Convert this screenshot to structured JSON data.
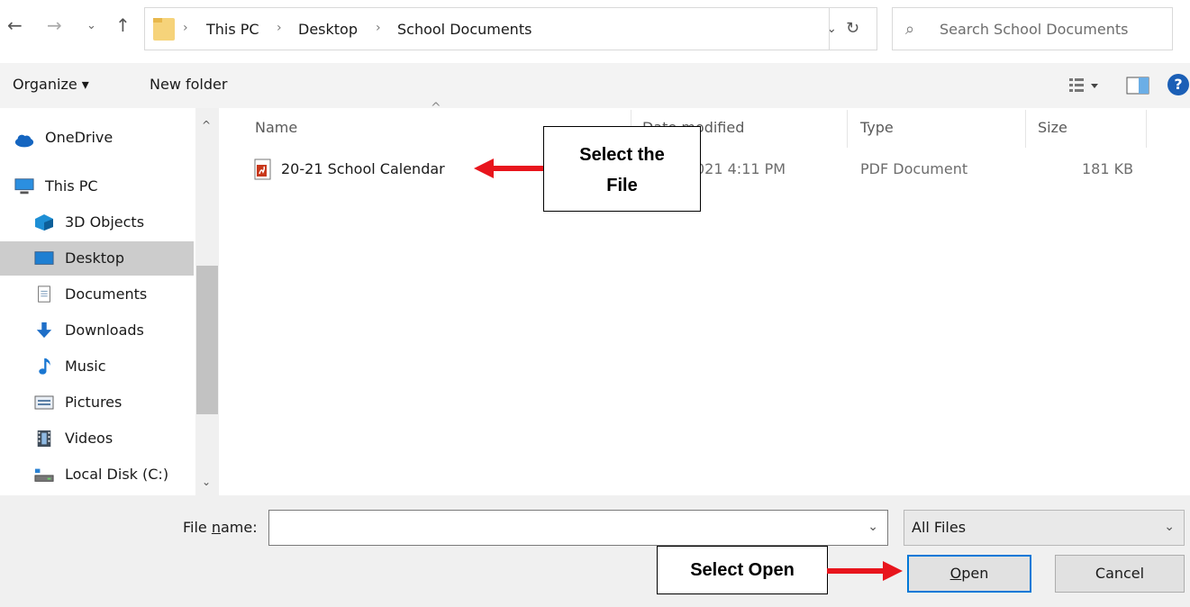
{
  "nav": {
    "back_icon": "back-arrow-icon",
    "forward_icon": "forward-arrow-icon",
    "recent_icon": "chevron-down-icon",
    "up_icon": "up-arrow-icon"
  },
  "address_bar": {
    "breadcrumbs": [
      "This PC",
      "Desktop",
      "School Documents"
    ],
    "separator": "›"
  },
  "search": {
    "placeholder": "Search School Documents"
  },
  "toolbar": {
    "organize_label": "Organize ▾",
    "new_folder_label": "New folder"
  },
  "sidebar": {
    "items": [
      {
        "label": "OneDrive",
        "icon": "cloud-icon"
      },
      {
        "label": "This PC",
        "icon": "computer-icon"
      },
      {
        "label": "3D Objects",
        "icon": "cube-icon"
      },
      {
        "label": "Desktop",
        "icon": "desktop-icon",
        "selected": true
      },
      {
        "label": "Documents",
        "icon": "document-icon"
      },
      {
        "label": "Downloads",
        "icon": "download-icon"
      },
      {
        "label": "Music",
        "icon": "music-note-icon"
      },
      {
        "label": "Pictures",
        "icon": "picture-icon"
      },
      {
        "label": "Videos",
        "icon": "film-icon"
      },
      {
        "label": "Local Disk (C:)",
        "icon": "drive-icon"
      }
    ]
  },
  "file_list": {
    "columns": [
      "Name",
      "Date modified",
      "Type",
      "Size"
    ],
    "rows": [
      {
        "name": "20-21 School Calendar",
        "date": "021 4:11 PM",
        "type": "PDF Document",
        "size": "181 KB",
        "icon": "pdf-icon"
      }
    ]
  },
  "callouts": {
    "file_line1": "Select the",
    "file_line2": "File",
    "open": "Select Open"
  },
  "footer": {
    "file_name_label_pre": "File ",
    "file_name_label_key": "n",
    "file_name_label_post": "ame:",
    "file_name_value": "",
    "filter_value": "All Files",
    "open_key": "O",
    "open_rest": "pen",
    "cancel_label": "Cancel"
  },
  "colors": {
    "accent": "#0078d7",
    "arrow": "#e8151d",
    "selected_bg": "#cccccc"
  }
}
